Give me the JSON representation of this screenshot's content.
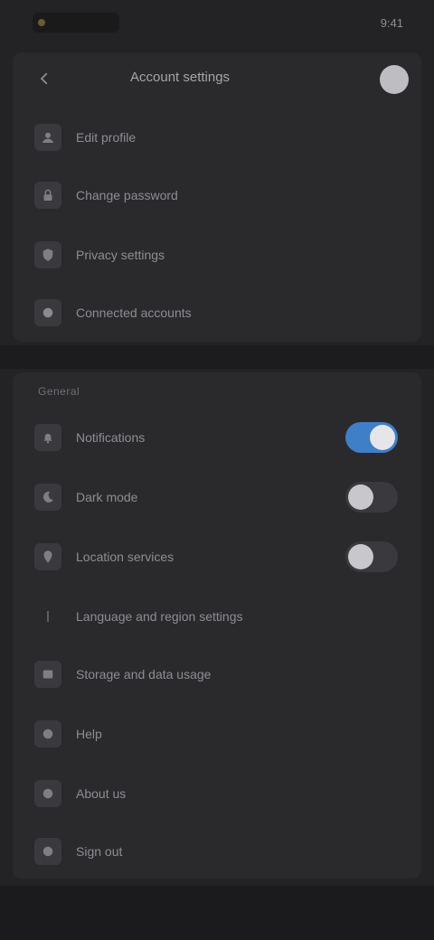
{
  "statusbar": {
    "right_text": "9:41"
  },
  "header": {
    "title": "Account settings"
  },
  "panel_items": [
    {
      "icon": "person-icon",
      "label": "Edit profile"
    },
    {
      "icon": "lock-icon",
      "label": "Change password"
    },
    {
      "icon": "shield-icon",
      "label": "Privacy settings"
    },
    {
      "icon": "link-icon",
      "label": "Connected accounts"
    }
  ],
  "section": {
    "title": "General",
    "items": [
      {
        "icon": "bell-icon",
        "label": "Notifications",
        "toggle": true,
        "on": true
      },
      {
        "icon": "moon-icon",
        "label": "Dark mode",
        "toggle": true,
        "on": false
      },
      {
        "icon": "location-icon",
        "label": "Location services",
        "toggle": true,
        "on": false
      },
      {
        "icon": "globe-icon",
        "label": "Language and region settings",
        "toggle": false
      },
      {
        "icon": "storage-icon",
        "label": "Storage and data usage",
        "toggle": false
      },
      {
        "icon": "help-icon",
        "label": "Help",
        "toggle": false
      },
      {
        "icon": "info-icon",
        "label": "About us",
        "toggle": false
      },
      {
        "icon": "logout-icon",
        "label": "Sign out",
        "toggle": false
      }
    ]
  }
}
